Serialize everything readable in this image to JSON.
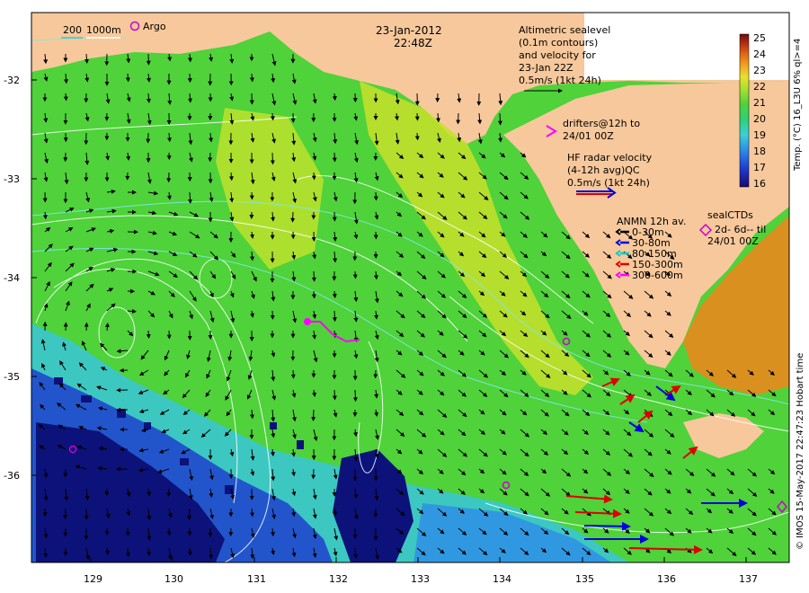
{
  "header": {
    "date": "23-Jan-2012",
    "time": "22:48Z"
  },
  "scale_bar": {
    "label_200": "200",
    "label_1000": "1000m"
  },
  "argo_label": "Argo",
  "altimetry": {
    "line1": "Altimetric sealevel",
    "line2": "(0.1m contours)",
    "line3": "and velocity for",
    "line4": "23-Jan 22Z",
    "line5": "0.5m/s (1kt 24h)"
  },
  "drifters": {
    "line1": "drifters@12h to",
    "line2": "24/01 00Z"
  },
  "hf_radar": {
    "line1": "HF radar velocity",
    "line2": "(4-12h avg)QC",
    "line3": "0.5m/s (1kt 24h)"
  },
  "anmn": {
    "title": "ANMN 12h av.",
    "items": [
      {
        "label": "0-30m",
        "color": "#000000"
      },
      {
        "label": "30-80m",
        "color": "#0000dd"
      },
      {
        "label": "80-150m",
        "color": "#00cccc"
      },
      {
        "label": "150-300m",
        "color": "#dd0000"
      },
      {
        "label": "300-600m",
        "color": "#ff00ff"
      }
    ]
  },
  "sealctd": {
    "title": "sealCTDs",
    "line1": "2d- 6d-- til",
    "line2": "24/01 00Z"
  },
  "colorbar": {
    "label": "Temp. (°C) 16_L3U 6% ql>=4",
    "ticks": [
      "25",
      "24",
      "23",
      "22",
      "21",
      "20",
      "19",
      "18",
      "17",
      "16"
    ],
    "min": 16,
    "max": 25,
    "colors": [
      "#1a0a6e",
      "#1e3cd0",
      "#2d8ce8",
      "#3ccfd8",
      "#2fd07a",
      "#4fd23a",
      "#a8e030",
      "#e8e030",
      "#f0a020",
      "#d86018",
      "#a82810",
      "#6e0c0c"
    ]
  },
  "axes": {
    "lon_ticks": [
      "129",
      "130",
      "131",
      "132",
      "133",
      "134",
      "135",
      "136",
      "137"
    ],
    "lat_ticks": [
      "-32",
      "-33",
      "-34",
      "-35",
      "-36"
    ],
    "lon_range": [
      128.2,
      137.6
    ],
    "lat_range": [
      -36.9,
      -31.2
    ]
  },
  "footer_vertical": "© IMOS 15-May-2017 22:47:23 Hobart time",
  "colors": {
    "land": "#f7c89b",
    "sea_green": "#4fd23a",
    "sea_yellow": "#d6e62a",
    "sea_cyan": "#3cc8c0",
    "sea_blue": "#2255cc",
    "sea_deep": "#0c127a",
    "sea_warm": "#e8881c"
  }
}
